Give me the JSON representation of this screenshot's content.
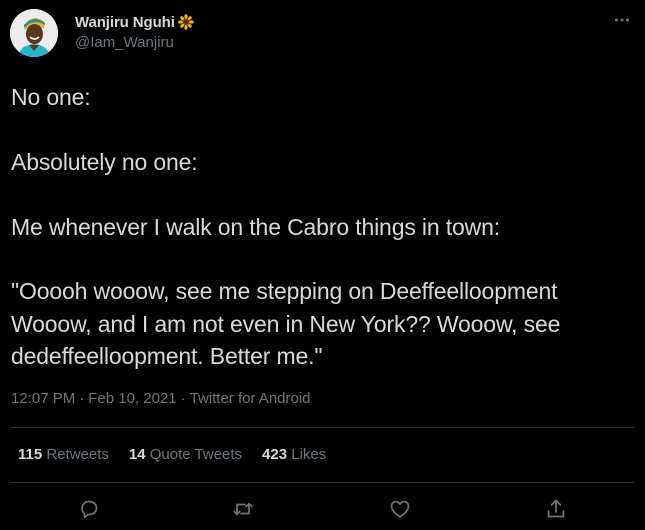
{
  "author": {
    "display_name": "Wanjiru Nguhi",
    "display_name_emoji": "sunflower-icon",
    "handle": "@Iam_Wanjiru"
  },
  "tweet": {
    "lines": [
      "No one:",
      "",
      "Absolutely no one:",
      "",
      "Me whenever I walk on the Cabro things in town:",
      "",
      "\"Ooooh wooow, see me stepping on Deeffeelloopment",
      "Wooow, and I am not even in New York?? Wooow, see",
      "dedeffeelloopment. Better me.\""
    ]
  },
  "meta": {
    "time": "12:07 PM",
    "separator1": "·",
    "date": "Feb 10, 2021",
    "separator2": "·",
    "source": "Twitter for Android"
  },
  "stats": {
    "retweets_count": "115",
    "retweets_label": "Retweets",
    "quote_tweets_count": "14",
    "quote_tweets_label": "Quote Tweets",
    "likes_count": "423",
    "likes_label": "Likes"
  },
  "actions": {
    "reply_icon": "reply-icon",
    "retweet_icon": "retweet-icon",
    "like_icon": "like-icon",
    "share_icon": "share-icon"
  },
  "colors": {
    "background": "#000000",
    "text_primary": "#d9d9d9",
    "text_secondary": "#6e767d",
    "divider": "#2f3336",
    "icon": "#6e767d"
  }
}
